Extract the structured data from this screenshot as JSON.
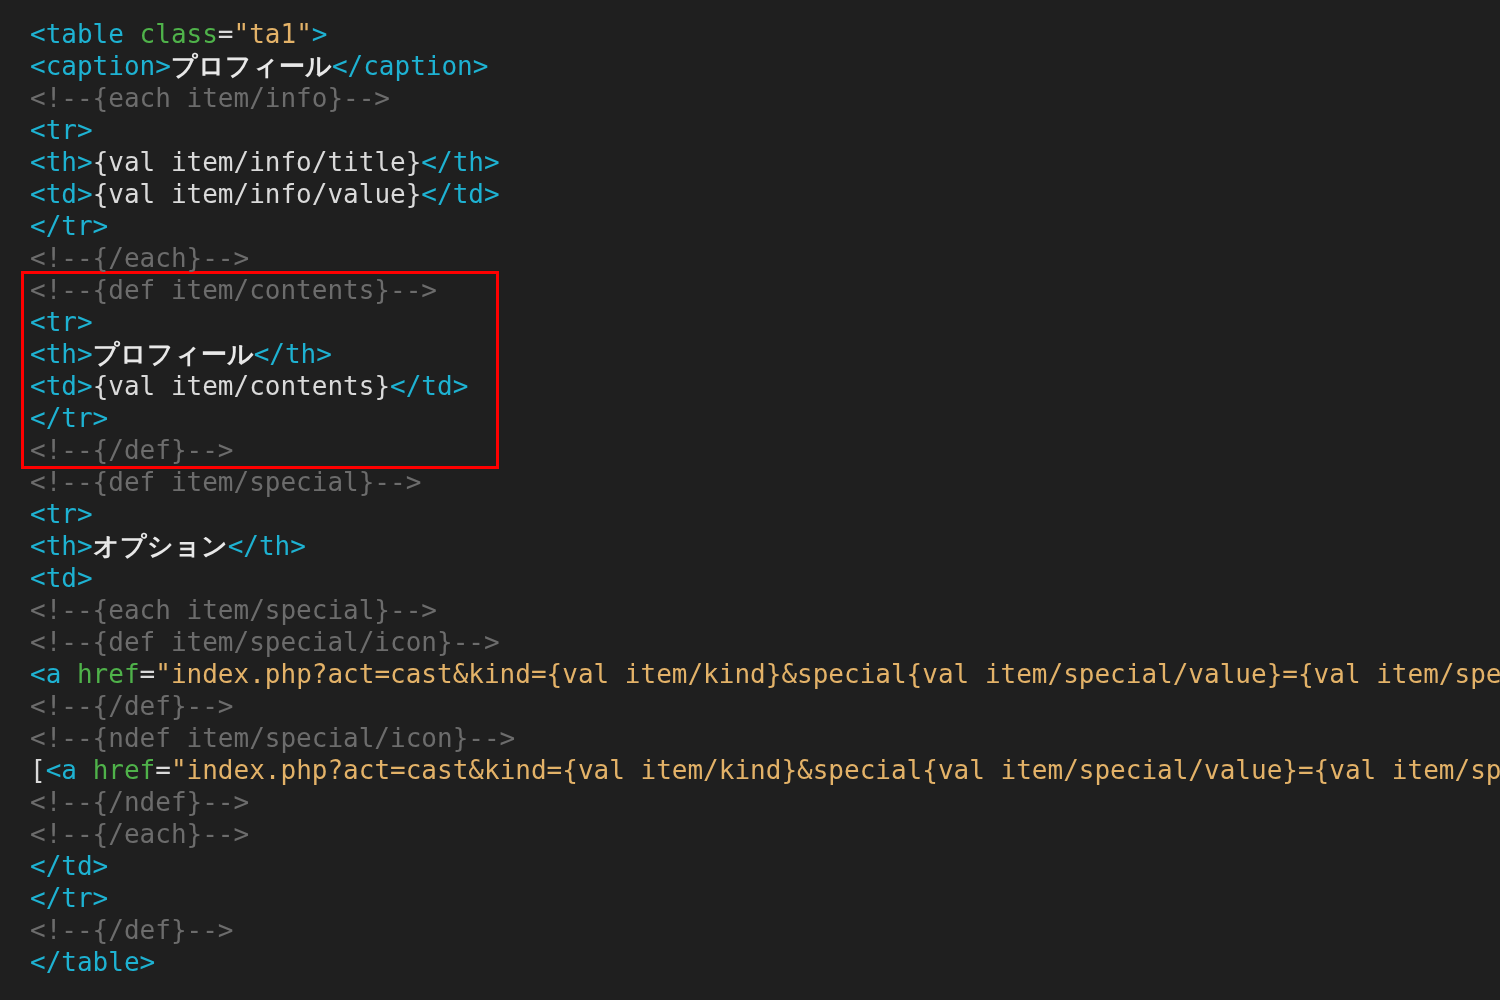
{
  "blocks": [
    {
      "highlighted": false,
      "lines": [
        [
          {
            "kind": "tag",
            "text": "<table "
          },
          {
            "kind": "attr",
            "text": "class"
          },
          {
            "kind": "text",
            "text": "="
          },
          {
            "kind": "string",
            "text": "\"ta1\""
          },
          {
            "kind": "tag",
            "text": ">"
          }
        ],
        [
          {
            "kind": "tag",
            "text": "<caption>"
          },
          {
            "kind": "bold",
            "text": "プロフィール"
          },
          {
            "kind": "tag",
            "text": "</caption>"
          }
        ],
        [
          {
            "kind": "comment",
            "text": "<!--{each item/info}-->"
          }
        ],
        [
          {
            "kind": "tag",
            "text": "<tr>"
          }
        ],
        [
          {
            "kind": "tag",
            "text": "<th>"
          },
          {
            "kind": "text",
            "text": "{val item/info/title}"
          },
          {
            "kind": "tag",
            "text": "</th>"
          }
        ],
        [
          {
            "kind": "tag",
            "text": "<td>"
          },
          {
            "kind": "text",
            "text": "{val item/info/value}"
          },
          {
            "kind": "tag",
            "text": "</td>"
          }
        ],
        [
          {
            "kind": "tag",
            "text": "</tr>"
          }
        ],
        [
          {
            "kind": "comment",
            "text": "<!--{/each}-->"
          }
        ]
      ]
    },
    {
      "highlighted": true,
      "lines": [
        [
          {
            "kind": "comment",
            "text": "<!--{def item/contents}-->"
          }
        ],
        [
          {
            "kind": "tag",
            "text": "<tr>"
          }
        ],
        [
          {
            "kind": "tag",
            "text": "<th>"
          },
          {
            "kind": "bold",
            "text": "プロフィール"
          },
          {
            "kind": "tag",
            "text": "</th>"
          }
        ],
        [
          {
            "kind": "tag",
            "text": "<td>"
          },
          {
            "kind": "text",
            "text": "{val item/contents}"
          },
          {
            "kind": "tag",
            "text": "</td>"
          }
        ],
        [
          {
            "kind": "tag",
            "text": "</tr>"
          }
        ],
        [
          {
            "kind": "comment",
            "text": "<!--{/def}-->"
          }
        ]
      ]
    },
    {
      "highlighted": false,
      "lines": [
        [
          {
            "kind": "comment",
            "text": "<!--{def item/special}-->"
          }
        ],
        [
          {
            "kind": "tag",
            "text": "<tr>"
          }
        ],
        [
          {
            "kind": "tag",
            "text": "<th>"
          },
          {
            "kind": "bold",
            "text": "オプション"
          },
          {
            "kind": "tag",
            "text": "</th>"
          }
        ],
        [
          {
            "kind": "tag",
            "text": "<td>"
          }
        ],
        [
          {
            "kind": "comment",
            "text": "<!--{each item/special}-->"
          }
        ],
        [
          {
            "kind": "comment",
            "text": "<!--{def item/special/icon}-->"
          }
        ],
        [
          {
            "kind": "tag",
            "text": "<a "
          },
          {
            "kind": "attr",
            "text": "href"
          },
          {
            "kind": "text",
            "text": "="
          },
          {
            "kind": "string",
            "text": "\"index.php?act=cast&kind={val item/kind}&special{val item/special/value}={val item/spe"
          }
        ],
        [
          {
            "kind": "comment",
            "text": "<!--{/def}-->"
          }
        ],
        [
          {
            "kind": "comment",
            "text": "<!--{ndef item/special/icon}-->"
          }
        ],
        [
          {
            "kind": "text",
            "text": "["
          },
          {
            "kind": "tag",
            "text": "<a "
          },
          {
            "kind": "attr",
            "text": "href"
          },
          {
            "kind": "text",
            "text": "="
          },
          {
            "kind": "string",
            "text": "\"index.php?act=cast&kind={val item/kind}&special{val item/special/value}={val item/sp"
          }
        ],
        [
          {
            "kind": "comment",
            "text": "<!--{/ndef}-->"
          }
        ],
        [
          {
            "kind": "comment",
            "text": "<!--{/each}-->"
          }
        ],
        [
          {
            "kind": "tag",
            "text": "</td>"
          }
        ],
        [
          {
            "kind": "tag",
            "text": "</tr>"
          }
        ],
        [
          {
            "kind": "comment",
            "text": "<!--{/def}-->"
          }
        ],
        [
          {
            "kind": "tag",
            "text": "</table>"
          }
        ]
      ]
    }
  ]
}
